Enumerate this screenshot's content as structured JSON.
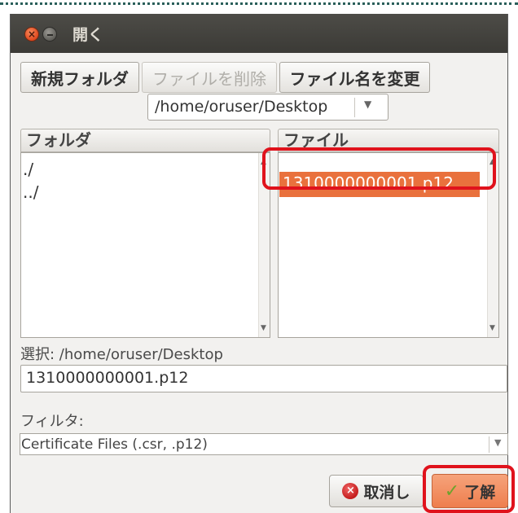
{
  "window": {
    "title": "開く"
  },
  "toolbar": {
    "new_folder": "新規フォルダ",
    "delete_file": "ファイルを削除",
    "rename_file": "ファイル名を変更"
  },
  "path_combo": {
    "value": "/home/oruser/Desktop"
  },
  "folders": {
    "header": "フォルダ",
    "items": [
      "./",
      "../"
    ]
  },
  "files": {
    "header": "ファイル",
    "items": [
      "1310000000001.p12"
    ],
    "selected_index": 0
  },
  "selection": {
    "label": "選択: /home/oruser/Desktop",
    "value": "1310000000001.p12"
  },
  "filter": {
    "label": "フィルタ:",
    "value": "Certificate Files (.csr, .p12)"
  },
  "actions": {
    "cancel": "取消し",
    "ok": "了解"
  },
  "colors": {
    "selection": "#e9713d",
    "highlight_box": "#e0121c",
    "titlebar": "#3f3e3a"
  }
}
